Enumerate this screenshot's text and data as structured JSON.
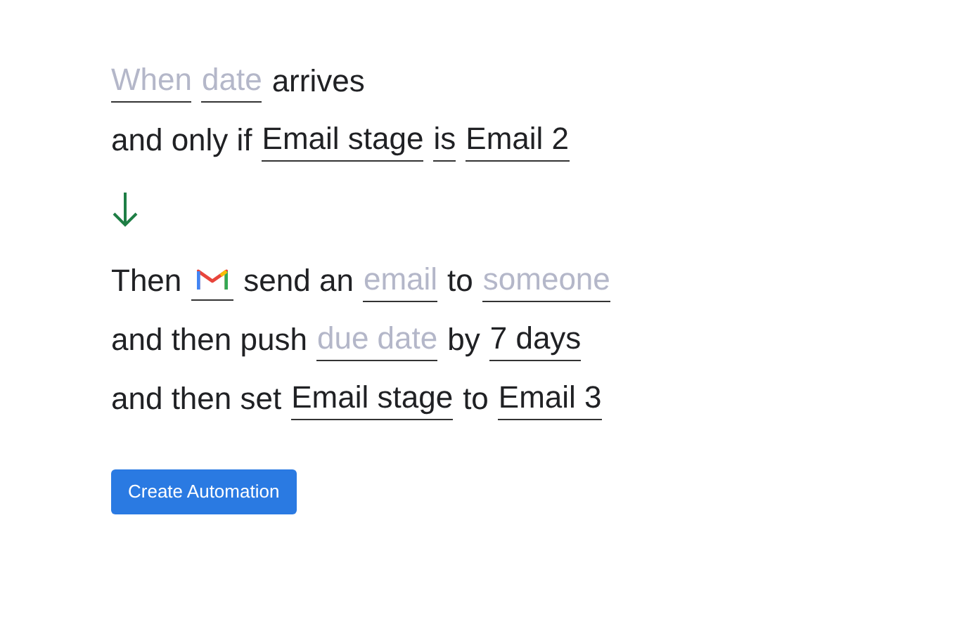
{
  "lines": [
    {
      "parts": [
        {
          "kind": "token",
          "text": "When",
          "filled": false
        },
        {
          "kind": "token",
          "text": "date",
          "filled": false
        },
        {
          "kind": "text",
          "text": "arrives"
        }
      ]
    },
    {
      "parts": [
        {
          "kind": "text",
          "text": "and only if"
        },
        {
          "kind": "token",
          "text": "Email stage",
          "filled": true
        },
        {
          "kind": "token",
          "text": "is",
          "filled": true
        },
        {
          "kind": "token",
          "text": "Email 2",
          "filled": true
        }
      ]
    },
    {
      "kind": "arrow"
    },
    {
      "parts": [
        {
          "kind": "text",
          "text": "Then"
        },
        {
          "kind": "app"
        },
        {
          "kind": "text",
          "text": "send an"
        },
        {
          "kind": "token",
          "text": "email",
          "filled": false
        },
        {
          "kind": "text",
          "text": "to"
        },
        {
          "kind": "token",
          "text": "someone",
          "filled": false
        }
      ]
    },
    {
      "parts": [
        {
          "kind": "text",
          "text": "and then push"
        },
        {
          "kind": "token",
          "text": "due date",
          "filled": false
        },
        {
          "kind": "text",
          "text": "by"
        },
        {
          "kind": "token",
          "text": "7 days",
          "filled": true
        }
      ]
    },
    {
      "parts": [
        {
          "kind": "text",
          "text": "and then set"
        },
        {
          "kind": "token",
          "text": "Email stage",
          "filled": true
        },
        {
          "kind": "text",
          "text": "to"
        },
        {
          "kind": "token",
          "text": "Email 3",
          "filled": true
        }
      ]
    }
  ],
  "button": "Create Automation"
}
